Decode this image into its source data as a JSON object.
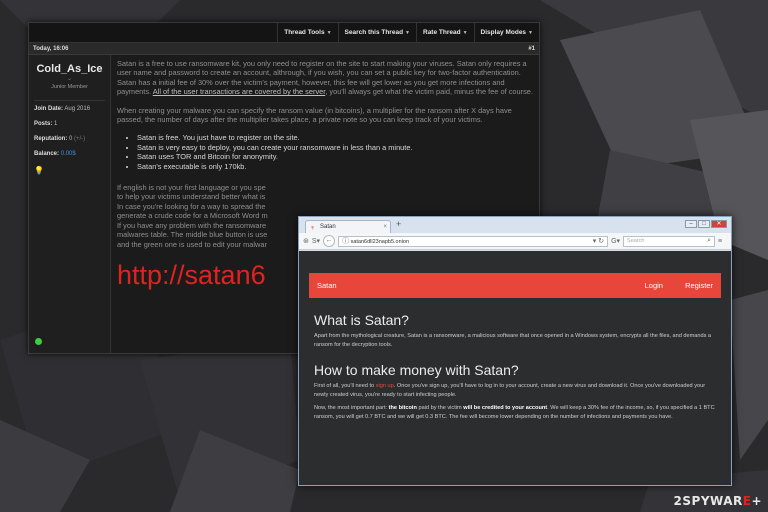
{
  "forum": {
    "toolbar": [
      "Thread Tools",
      "Search this Thread",
      "Rate Thread",
      "Display Modes"
    ],
    "post_date": "Today, 16:06",
    "post_number": "#1",
    "user": {
      "name": "Cold_As_Ice",
      "title": "Junior Member",
      "join_label": "Join Date:",
      "join_value": "Aug 2016",
      "posts_label": "Posts:",
      "posts_value": "1",
      "rep_label": "Reputation:",
      "rep_value": "0",
      "rep_extra": "(+/-)",
      "balance_label": "Balance:",
      "balance_value": "0.00$"
    },
    "p1": "Satan is a free to use ransomware kit, you only need to register on the site to start making your viruses. Satan only requires a user name and password to create an account, althrough, if you wish, you can set a public key for two-factor authentication. Satan has a initial fee of 30% over the victim's payment, however, this fee will get lower as you get more infections and payments.",
    "p1_link": "All of the user transactions are covered by the server",
    "p1_tail": ", you'll always get what the victim paid, minus the fee of course.",
    "p2": "When creating your malware you can specify the ransom value (in bitcoins), a multiplier for the ransom after X days have passed, the number of days after the multiplier takes place, a private note so you can keep track of your victims.",
    "bullets": [
      "Satan is free. You just have to register on the site.",
      "Satan is very easy to deploy, you can create your ransomware in less than a minute.",
      "Satan uses TOR and Bitcoin for anonymity.",
      "Satan's executable is only 170kb."
    ],
    "p3_lines": [
      "If english is not your first language or you spe",
      "to help your victims understand better what is",
      "In case you're looking for a way to spread the",
      "generate a crude code for a Microsoft Word m",
      "If you have any problem with the ransomware",
      "malwares table. The middle blue button is use",
      "and the green one is used to edit your malwar"
    ],
    "big_url": "http://satan6"
  },
  "browser": {
    "tab_title": "Satan",
    "new_tab": "+",
    "url": "satan6dll23napb5.onion",
    "search_placeholder": "Search",
    "site_brand": "Satan",
    "nav_login": "Login",
    "nav_register": "Register",
    "h1": "What is Satan?",
    "p1": "Apart from the mythological creature, Satan is a ransomware, a malicious software that once opened in a Windows system, encrypts all the files, and demands a ransom for the decryption tools.",
    "h2": "How to make money with Satan?",
    "p2_a": "First of all, you'll need to ",
    "p2_link": "sign up",
    "p2_b": ". Once you've sign up, you'll have to log in to your account, create a new virus and download it. Once you've downloaded your newly created virus, you're ready to start infecting people.",
    "p3_a": "Now, the most important part: ",
    "p3_b1": "the bitcoin",
    "p3_c": " paid by the victim ",
    "p3_b2": "will be credited to your account",
    "p3_d": ". We will keep a 30% fee of the income, so, if you specified a 1 BTC ransom, you will get 0.7 BTC and we will get 0.3 BTC. The fee will become lower depending on the number of infections and payments you have."
  },
  "watermark": {
    "a": "2SPYWAR",
    "b": "E",
    "c": "+"
  },
  "colors": {
    "accent_red": "#e8463b",
    "link_blue": "#3d8fe0",
    "online_green": "#3ccf3c"
  }
}
